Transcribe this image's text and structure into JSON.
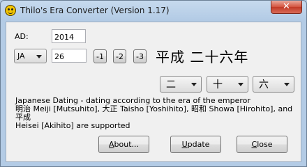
{
  "window": {
    "title": "Thilo's Era Converter (Version 1.17)",
    "close_glyph": "✕"
  },
  "form": {
    "ad_label": "AD:",
    "ad_value": "2014",
    "era_selected": "JA",
    "era_year_value": "26",
    "step_buttons": [
      "-1",
      "-2",
      "-3"
    ],
    "kanji_year": "平成 二十六年",
    "kanji_selects": [
      "二",
      "十",
      "六"
    ]
  },
  "info": {
    "line1": "Japanese Dating - dating according to the era of the emperor",
    "line2": "明治 Meiji [Mutsuhito], 大正 Taisho [Yoshihito], 昭和 Showa [Hirohito], and 平成",
    "line3": "Heisei [Akihito] are supported"
  },
  "buttons": {
    "about_accel": "A",
    "about_rest": "bout...",
    "update_accel": "U",
    "update_rest": "pdate",
    "close_accel": "C",
    "close_rest": "lose"
  }
}
